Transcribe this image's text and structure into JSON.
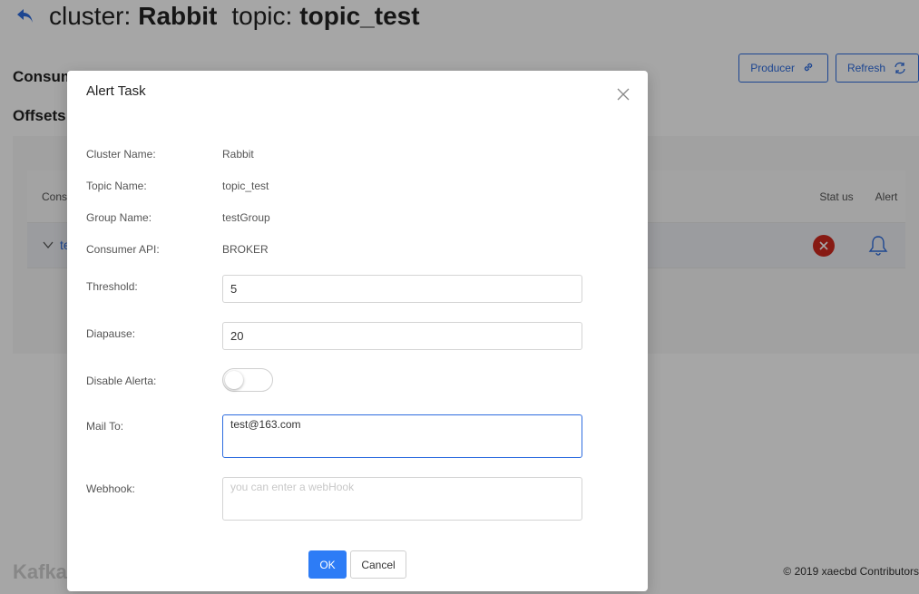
{
  "header": {
    "cluster_label": "cluster:",
    "cluster_name": "Rabbit",
    "topic_label": "topic:",
    "topic_name": "topic_test"
  },
  "toolbar": {
    "producer_label": "Producer",
    "refresh_label": "Refresh"
  },
  "sections": {
    "consumers_label": "Consum",
    "offsets_label": "Offsets"
  },
  "table": {
    "columns": {
      "consumer": "Cons",
      "status": "Stat us",
      "alert": "Alert"
    },
    "rows": [
      {
        "name": "te",
        "status": "error"
      }
    ]
  },
  "footer": {
    "brand": "Kafka",
    "copyright": "© 2019 xaecbd Contributors"
  },
  "modal": {
    "title": "Alert Task",
    "fields": {
      "cluster_name_label": "Cluster Name:",
      "cluster_name_value": "Rabbit",
      "topic_name_label": "Topic Name:",
      "topic_name_value": "topic_test",
      "group_name_label": "Group Name:",
      "group_name_value": "testGroup",
      "consumer_api_label": "Consumer API:",
      "consumer_api_value": "BROKER",
      "threshold_label": "Threshold:",
      "threshold_value": "5",
      "diapause_label": "Diapause:",
      "diapause_value": "20",
      "disable_alerts_label": "Disable Alerta:",
      "disable_alerts_on": false,
      "mail_to_label": "Mail To:",
      "mail_to_value": "test@163.com",
      "webhook_label": "Webhook:",
      "webhook_placeholder": "you can enter a webHook"
    },
    "ok_label": "OK",
    "cancel_label": "Cancel"
  },
  "colors": {
    "accent": "#2d6cdf",
    "primary_button": "#2d7cf6",
    "error": "#d0281e"
  }
}
